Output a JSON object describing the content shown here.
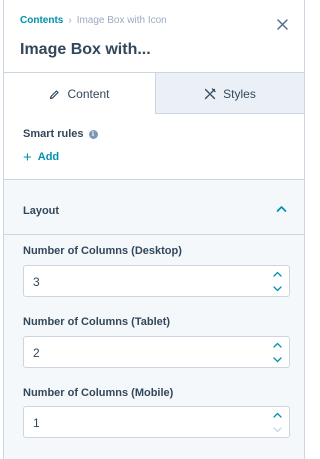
{
  "header": {
    "breadcrumb_root": "Contents",
    "breadcrumb_separator": "›",
    "breadcrumb_current": "Image Box with Icon",
    "title": "Image Box with...",
    "close_icon": "close-icon"
  },
  "tabs": [
    {
      "label": "Content",
      "icon": "pencil-icon",
      "active": true
    },
    {
      "label": "Styles",
      "icon": "styles-icon",
      "active": false
    }
  ],
  "smart_rules": {
    "label": "Smart rules",
    "info_icon": "info-icon",
    "add_label": "Add"
  },
  "layout": {
    "title": "Layout",
    "expanded": true,
    "fields": [
      {
        "label": "Number of Columns (Desktop)",
        "value": "3"
      },
      {
        "label": "Number of Columns (Tablet)",
        "value": "2"
      },
      {
        "label": "Number of Columns (Mobile)",
        "value": "1"
      }
    ]
  },
  "colors": {
    "accent": "#0091ae",
    "text": "#33475b",
    "border": "#cbd6e2",
    "panel_bg": "#f5f8fa",
    "tab_bg": "#eaf0f6"
  }
}
